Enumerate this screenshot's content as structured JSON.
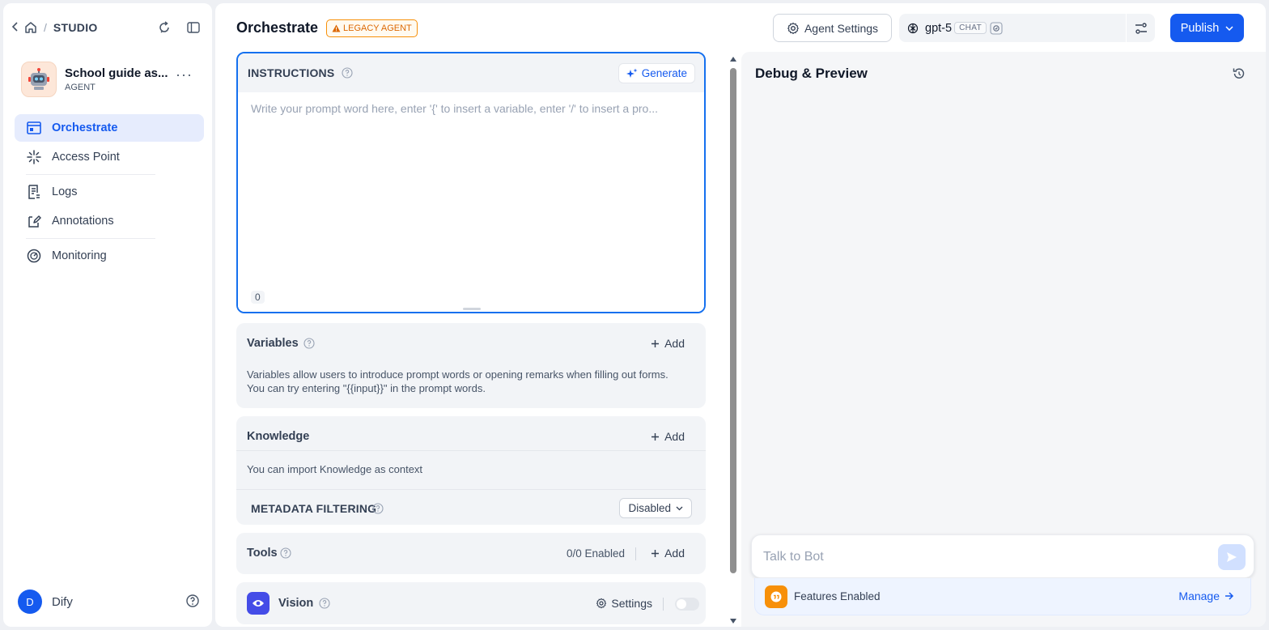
{
  "breadcrumb": {
    "section": "STUDIO"
  },
  "app": {
    "name": "School guide as...",
    "type": "AGENT",
    "more": "···"
  },
  "nav": {
    "items": [
      {
        "label": "Orchestrate"
      },
      {
        "label": "Access Point"
      },
      {
        "label": "Logs"
      },
      {
        "label": "Annotations"
      },
      {
        "label": "Monitoring"
      }
    ]
  },
  "user": {
    "initial": "D",
    "name": "Dify"
  },
  "header": {
    "title": "Orchestrate",
    "legacy_badge": "LEGACY AGENT",
    "agent_settings_label": "Agent Settings",
    "model_name": "gpt-5",
    "model_mode": "CHAT",
    "publish_label": "Publish"
  },
  "instructions": {
    "title": "INSTRUCTIONS",
    "generate_label": "Generate",
    "placeholder": "Write your prompt word here, enter '{' to insert a variable, enter '/' to insert a pro...",
    "value": "",
    "char_count": "0"
  },
  "variables": {
    "title": "Variables",
    "add_label": "Add",
    "description": "Variables allow users to introduce prompt words or opening remarks when filling out forms. You can try entering \"{{input}}\" in the prompt words."
  },
  "knowledge": {
    "title": "Knowledge",
    "add_label": "Add",
    "description": "You can import Knowledge as context",
    "metadata_label": "METADATA FILTERING",
    "metadata_value": "Disabled"
  },
  "tools": {
    "title": "Tools",
    "enabled_count": "0/0 Enabled",
    "add_label": "Add"
  },
  "vision": {
    "title": "Vision",
    "settings_label": "Settings",
    "enabled": false
  },
  "debug": {
    "title": "Debug & Preview",
    "chat_placeholder": "Talk to Bot",
    "features_label": "Features Enabled",
    "manage_label": "Manage"
  },
  "colors": {
    "accent": "#155aef",
    "legacy": "#dc6803",
    "vision": "#444ce7",
    "features": "#f79009"
  }
}
